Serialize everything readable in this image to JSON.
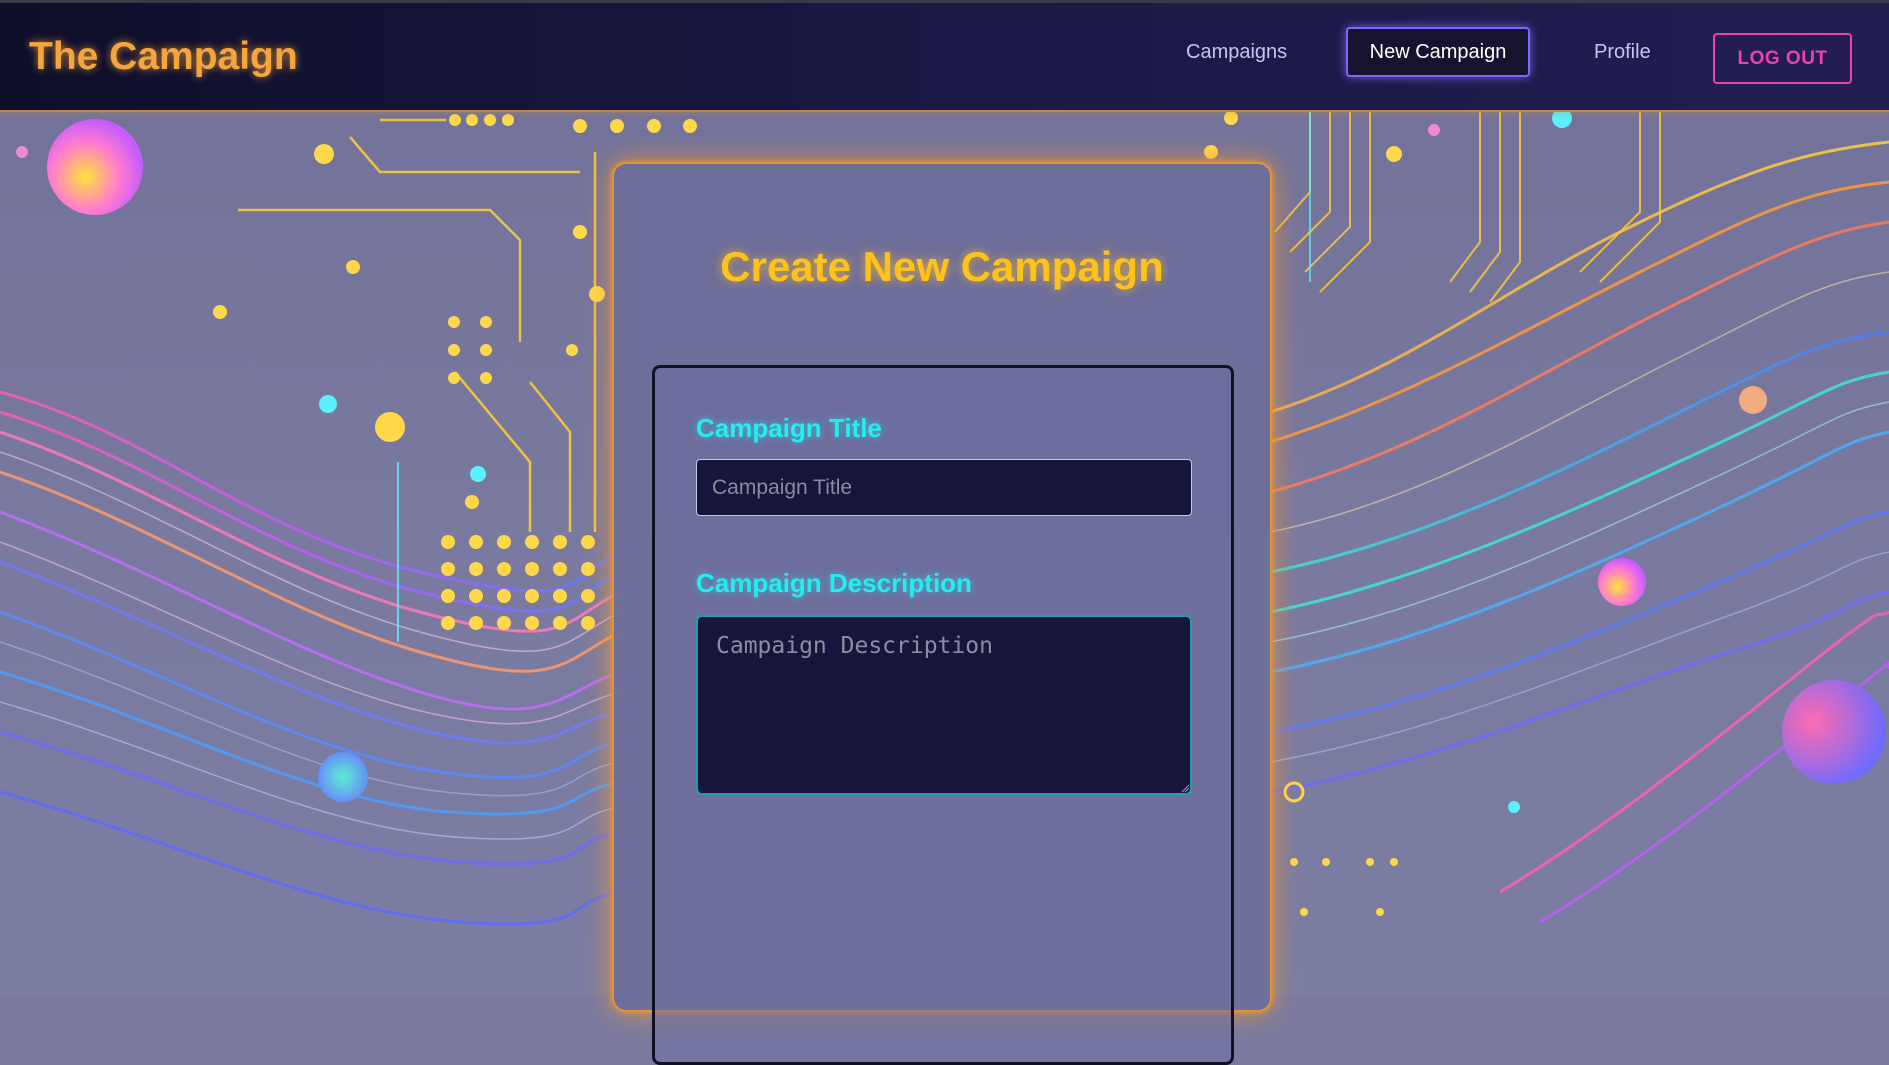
{
  "header": {
    "brand": "The Campaign",
    "nav": {
      "campaigns": "Campaigns",
      "new_campaign": "New Campaign",
      "profile": "Profile",
      "logout": "LOG OUT"
    }
  },
  "form": {
    "heading": "Create New Campaign",
    "title_label": "Campaign Title",
    "title_placeholder": "Campaign Title",
    "title_value": "",
    "description_label": "Campaign Description",
    "description_placeholder": "Campaign Description",
    "description_value": ""
  },
  "colors": {
    "brand": "#f5a53c",
    "heading": "#ffc21a",
    "label": "#22eef0",
    "logout": "#ee3fb4",
    "active_nav_border": "#7f66ff",
    "card_glow": "#e29433",
    "input_bg": "#16163c"
  }
}
